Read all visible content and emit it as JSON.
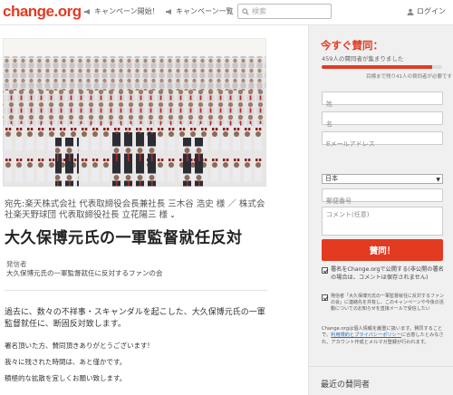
{
  "header": {
    "logo": "change.org",
    "nav_start": "キャンペーン開始！",
    "nav_list": "キャンペーン一覧",
    "search_placeholder": "検索",
    "login": "ログイン"
  },
  "petition": {
    "addressee": "宛先:楽天株式会社 代表取締役会長兼社長 三木谷 浩史 様 ／ 株式会社楽天野球団 代表取締役社長 立花陽三 様",
    "title": "大久保博元氏の一軍監督就任反対",
    "starter_label": "発信者",
    "starter_name": "大久保博元氏の一軍監督就任に反対するファンの会",
    "body": "過去に、数々の不祥事・スキャンダルを起こした、大久保博元氏の一軍監督就任に、断固反対致します。",
    "p1": "署名頂いた方、賛同頂きありがとうございます!",
    "p2": "我々に残された時間は、あと僅かです。",
    "p3": "積極的な拡散を宜しくお願い致します。"
  },
  "sidebar": {
    "title": "今すぐ賛同：",
    "count": "459人の賛同者が集まりました",
    "progress": 0.92,
    "goal": "目標まで残り41人の賛同者が必要です！",
    "last_name_placeholder": "姓",
    "first_name_placeholder": "名",
    "email_placeholder": "Eメールアドレス",
    "country": "日本",
    "zip_placeholder": "郵便番号",
    "comment_placeholder": "コメント(任意)",
    "button": "賛同！",
    "check1": "署名をChange.orgで公開する(非公開の署名の場合は、コメントは保存されません)",
    "check2": "発信者「大久保博元氏の一軍監督就任に反対するファンの会」に連絡先を共有し、このキャンペーンや今後の活動についてのお知らせを直接メールで受信したい",
    "privacy_pre": "Change.orgは個人情報を厳重に扱います。賛同することで、",
    "privacy_link": "利用規約とプライバシーポリシー",
    "privacy_post": "に合意したとみなされ、アカウント作成とメルマガ登録が行われます。",
    "recent": "最近の賛同者"
  },
  "colors": {
    "brand": "#e23b22"
  }
}
